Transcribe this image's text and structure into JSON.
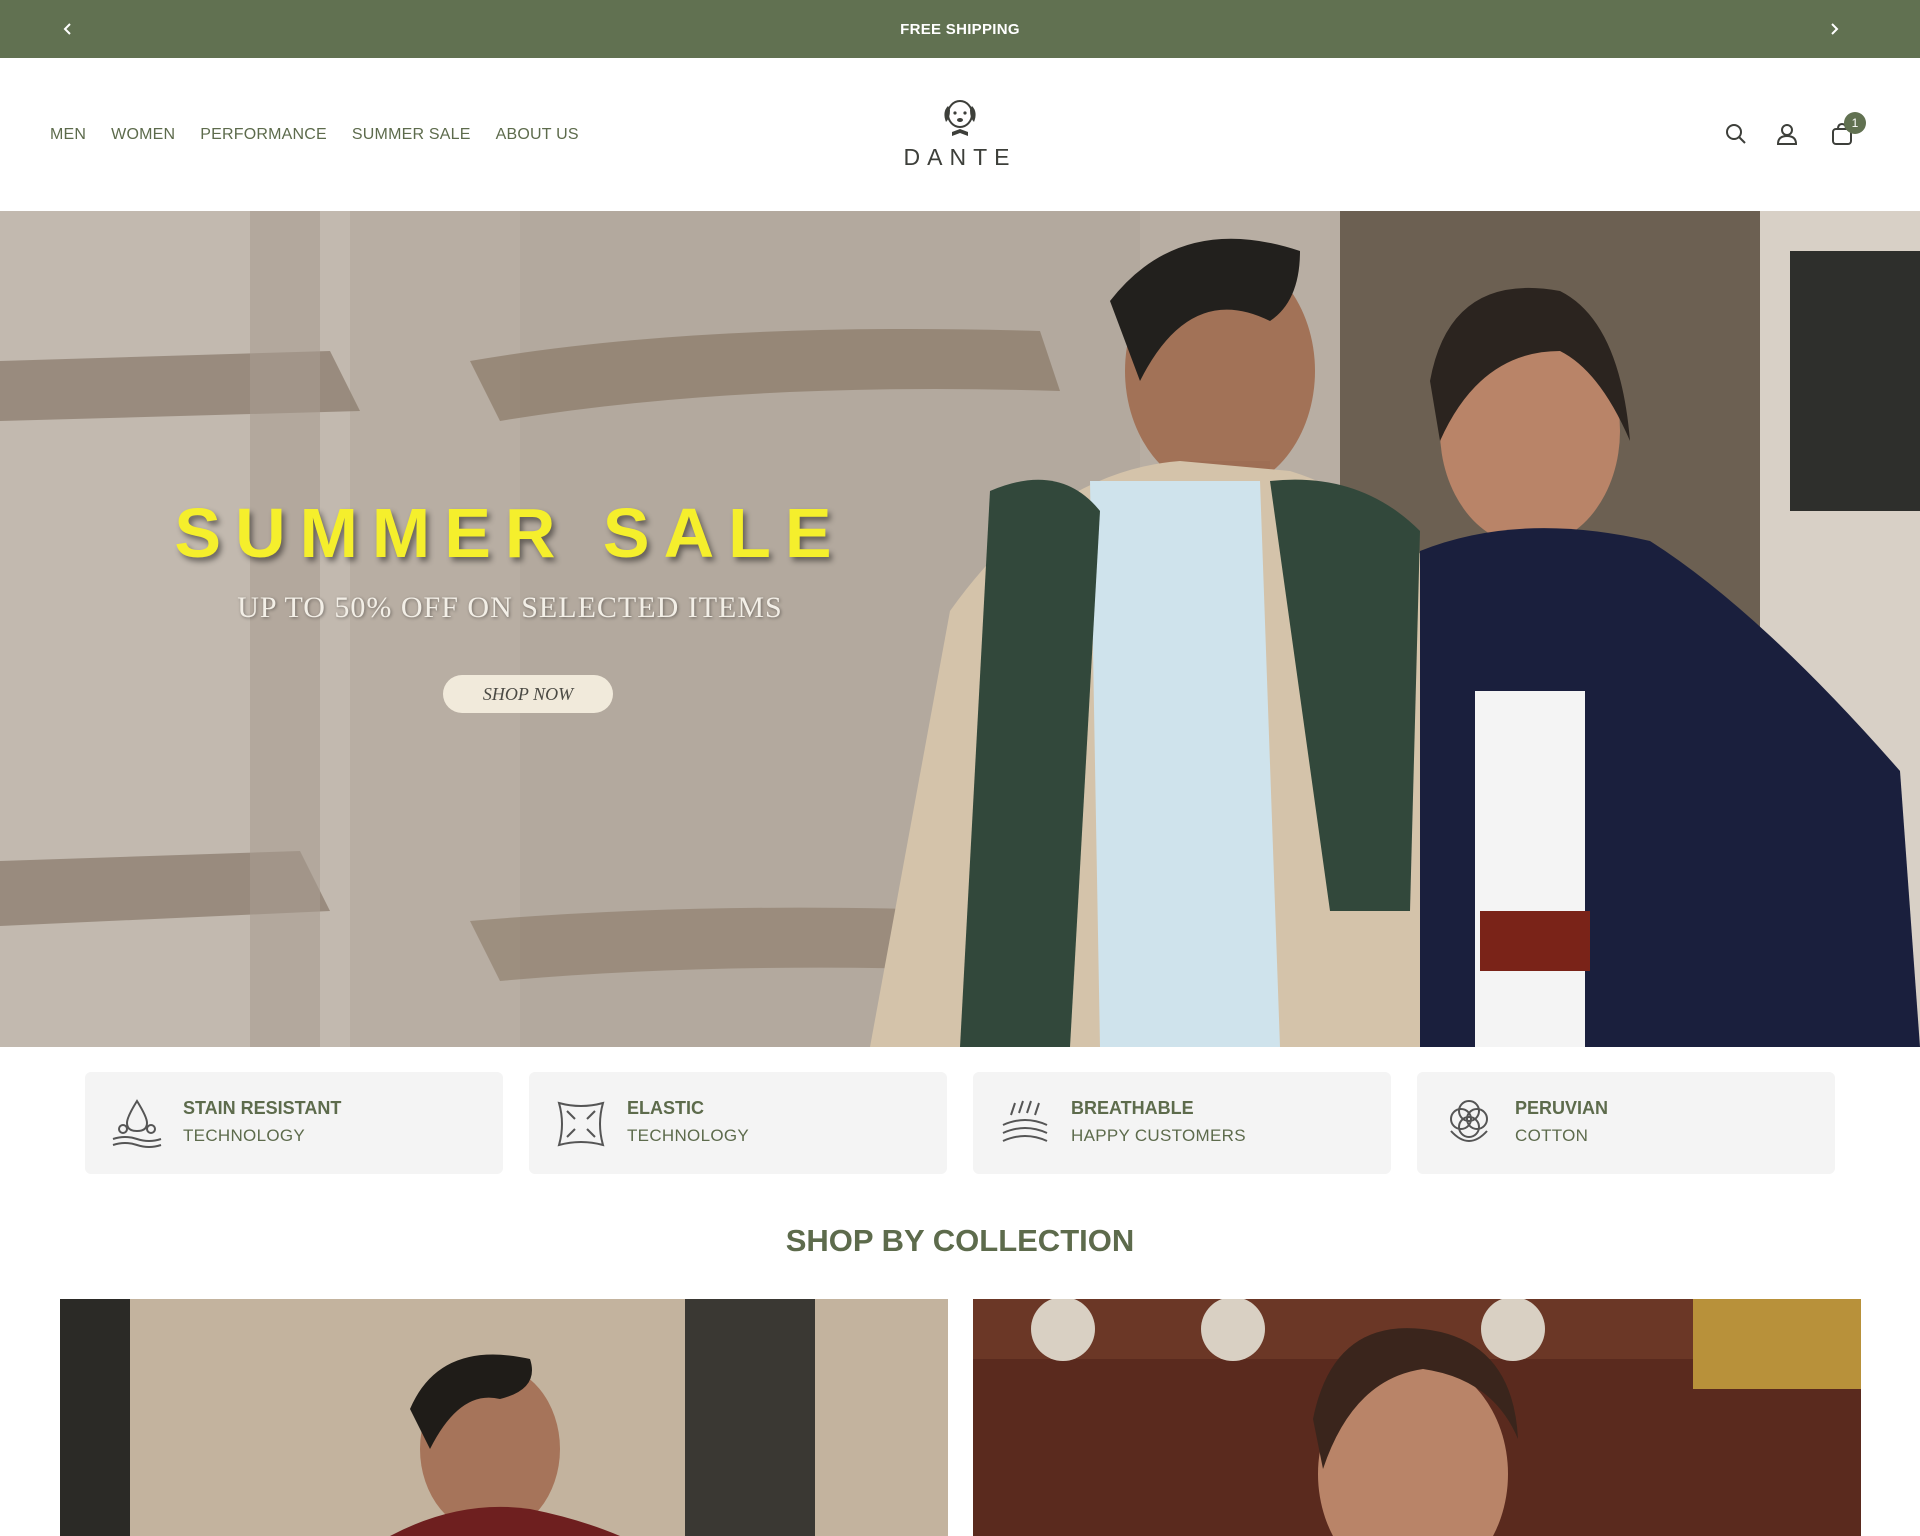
{
  "announcement": {
    "message": "FREE SHIPPING",
    "prev_icon": "chevron-left-icon",
    "next_icon": "chevron-right-icon"
  },
  "nav": {
    "items": [
      {
        "label": "MEN"
      },
      {
        "label": "WOMEN"
      },
      {
        "label": "PERFORMANCE"
      },
      {
        "label": "SUMMER SALE"
      },
      {
        "label": "ABOUT US"
      }
    ]
  },
  "brand": {
    "name": "DANTE",
    "logo_icon": "dog-head-logo-icon"
  },
  "header_icons": {
    "search": "search-icon",
    "account": "user-icon",
    "cart": "shopping-bag-icon",
    "cart_count": "1"
  },
  "hero": {
    "title": "SUMMER SALE",
    "subtitle": "UP TO 50% OFF ON SELECTED ITEMS",
    "cta_label": "SHOP NOW"
  },
  "features": [
    {
      "title": "STAIN RESISTANT",
      "subtitle": "TECHNOLOGY",
      "icon": "water-drop-icon"
    },
    {
      "title": "ELASTIC",
      "subtitle": "TECHNOLOGY",
      "icon": "stretch-fabric-icon"
    },
    {
      "title": "BREATHABLE",
      "subtitle": "HAPPY CUSTOMERS",
      "icon": "breathable-fabric-icon"
    },
    {
      "title": "PERUVIAN",
      "subtitle": "COTTON",
      "icon": "cotton-flower-icon"
    }
  ],
  "collection_section": {
    "title": "SHOP BY COLLECTION"
  },
  "colors": {
    "brand_green": "#617151",
    "text_green": "#5d6b4c",
    "hero_title_yellow": "#f5ef2c",
    "feature_bg": "#f4f4f4"
  }
}
